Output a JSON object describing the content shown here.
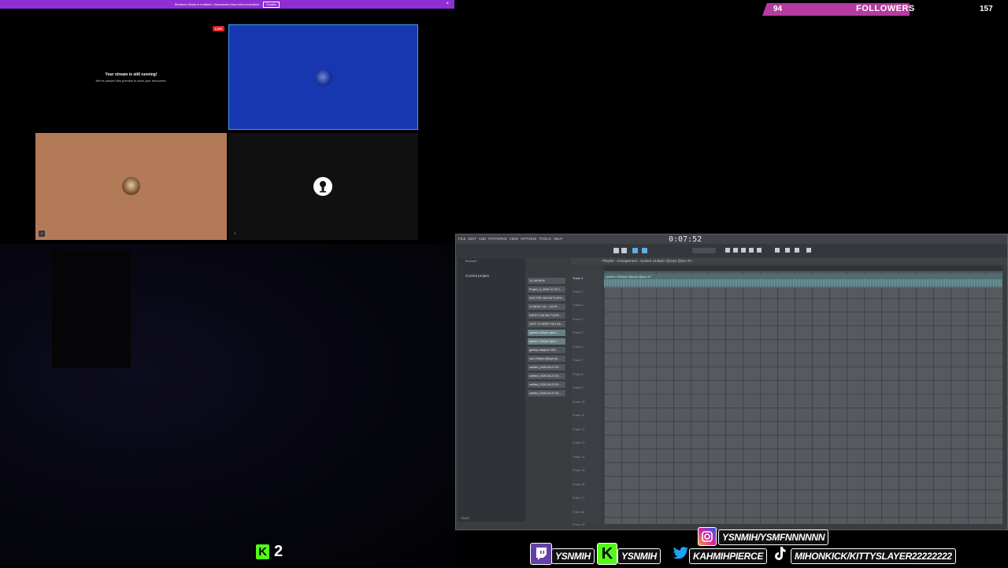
{
  "banner": {
    "text": "Streamer Mode is enabled. Usernames have been truncated.",
    "disable_label": "Disable",
    "close_glyph": "×"
  },
  "tiles": {
    "live_badge": "LIVE",
    "notice_title": "Your stream is still running!",
    "notice_body": "We've paused this preview to save your resources."
  },
  "followers": {
    "current": "94",
    "label": "FOLLOWERS",
    "goal": "157",
    "progress_fraction": 0.6,
    "bar_color": "#b63ba0"
  },
  "fl": {
    "menu": [
      "FILE",
      "EDIT",
      "ADD",
      "PATTERNS",
      "VIEW",
      "OPTIONS",
      "TOOLS",
      "HELP"
    ],
    "time": "0:07:52",
    "browser_title": "Browser",
    "browser_item": "Current project",
    "browser_tags": "TAGS",
    "playlist_title": "Playlist - Arrangement › system 144bpm @sopt @ysx #2 ›",
    "patterns": [
      "16 169 BPM",
      "Project_6_2026-12-29 1...",
      "DOCTOR 155 DM PLAYG...",
      "X KNOW 140 - 132 PL...",
      "HATES 166 DM PLAYB...",
      "JUST TO KEEP YOU SA...",
      "system 144bpm @so...",
      "system 144bpm @so...",
      "gummy clappers 152...",
      "vas 140bpm @sopt @...",
      "untitled_2026-06-23 00:...",
      "untitled_2026-06-23 00:...",
      "untitled_2026-06-23 00:...",
      "untitled_2026-06-23 00:..."
    ],
    "tracks": [
      "Track 1",
      "Track 2",
      "Track 3",
      "Track 4",
      "Track 5",
      "Track 6",
      "Track 7",
      "Track 8",
      "Track 9",
      "Track 10",
      "Track 11",
      "Track 12",
      "Track 13",
      "Track 14",
      "Track 15",
      "Track 16",
      "Track 17",
      "Track 18",
      "Track 19"
    ],
    "clip_label": "system 144bpm @sopt @ysx #2"
  },
  "kick": {
    "badge": "K",
    "count": "2",
    "color": "#53fc18"
  },
  "socials": {
    "instagram": "YSNMIH/YSMFNNNNNN",
    "twitch": "YSNMIH",
    "kick": "YSNMIH",
    "twitter": "KAHMIHPIERCE",
    "tiktok": "MIHONKICK/KITTYSLAYER22222222"
  }
}
